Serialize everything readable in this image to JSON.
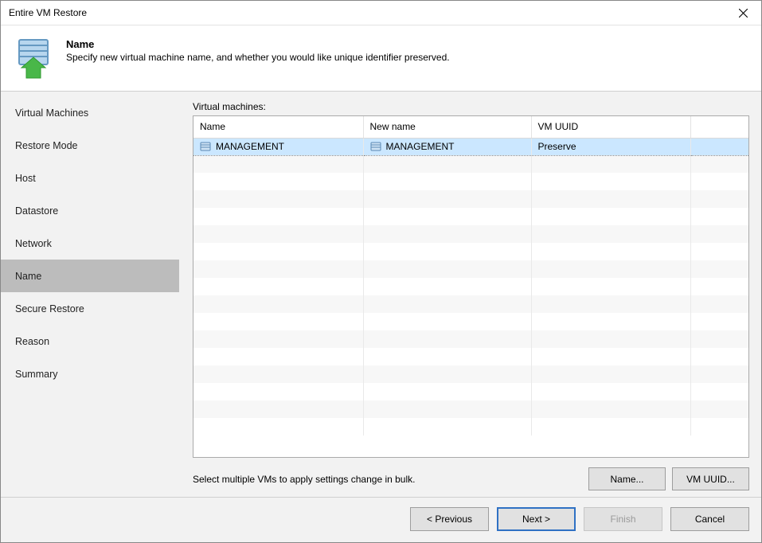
{
  "window": {
    "title": "Entire VM Restore"
  },
  "header": {
    "step_name": "Name",
    "step_desc": "Specify new virtual machine name, and whether you would like unique identifier preserved."
  },
  "sidebar": {
    "items": [
      {
        "label": "Virtual Machines",
        "active": false
      },
      {
        "label": "Restore Mode",
        "active": false
      },
      {
        "label": "Host",
        "active": false
      },
      {
        "label": "Datastore",
        "active": false
      },
      {
        "label": "Network",
        "active": false
      },
      {
        "label": "Name",
        "active": true
      },
      {
        "label": "Secure Restore",
        "active": false
      },
      {
        "label": "Reason",
        "active": false
      },
      {
        "label": "Summary",
        "active": false
      }
    ]
  },
  "main": {
    "section_label": "Virtual machines:",
    "columns": [
      "Name",
      "New name",
      "VM UUID"
    ],
    "col_widths": [
      "213px",
      "211px",
      "200px",
      null
    ],
    "rows": [
      {
        "name": "MANAGEMENT",
        "new_name": "MANAGEMENT",
        "vm_uuid": "Preserve",
        "selected": true
      }
    ],
    "empty_row_count": 16,
    "hint": "Select multiple VMs to apply settings change in bulk.",
    "name_button": "Name...",
    "uuid_button": "VM UUID..."
  },
  "footer": {
    "previous": "< Previous",
    "next": "Next >",
    "finish": "Finish",
    "cancel": "Cancel"
  },
  "icon_names": {
    "restore_header": "vm-restore-icon",
    "vm": "server-icon",
    "close": "close-icon"
  }
}
